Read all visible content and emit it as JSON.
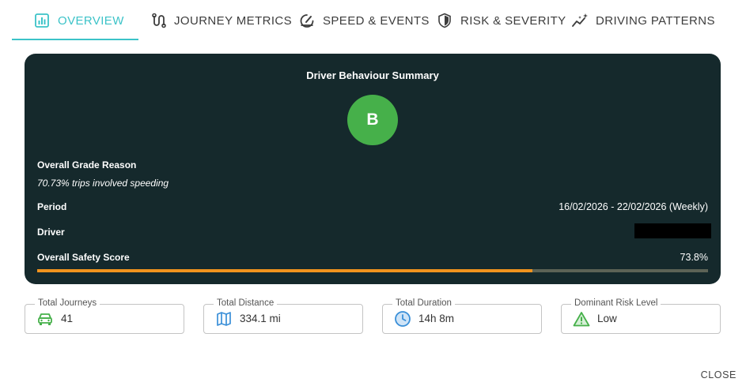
{
  "tabs": [
    {
      "label": "OVERVIEW",
      "icon": "bar-chart-icon",
      "active": true
    },
    {
      "label": "JOURNEY METRICS",
      "icon": "route-icon",
      "active": false
    },
    {
      "label": "SPEED & EVENTS",
      "icon": "speedometer-icon",
      "active": false
    },
    {
      "label": "RISK & SEVERITY",
      "icon": "shield-icon",
      "active": false
    },
    {
      "label": "DRIVING PATTERNS",
      "icon": "sparkle-trend-icon",
      "active": false
    }
  ],
  "summary": {
    "title": "Driver Behaviour Summary",
    "grade": "B",
    "grade_color": "#46b04a",
    "reason_label": "Overall Grade Reason",
    "reason_text": "70.73% trips involved speeding",
    "period_label": "Period",
    "period_value": "16/02/2026 - 22/02/2026 (Weekly)",
    "driver_label": "Driver",
    "safety_label": "Overall Safety Score",
    "safety_value": "73.8%",
    "safety_fraction": 0.738,
    "card_color": "#15292c",
    "bar_color": "#f0931e"
  },
  "stats": [
    {
      "label": "Total Journeys",
      "value": "41",
      "icon": "car-icon",
      "color": "#46b04a"
    },
    {
      "label": "Total Distance",
      "value": "334.1 mi",
      "icon": "map-icon",
      "color": "#3a8fd8"
    },
    {
      "label": "Total Duration",
      "value": "14h 8m",
      "icon": "clock-icon",
      "color": "#3a8fd8"
    },
    {
      "label": "Dominant Risk Level",
      "value": "Low",
      "icon": "warning-icon",
      "color": "#46b04a"
    }
  ],
  "close_label": "CLOSE",
  "accent_color": "#3cc3c8"
}
